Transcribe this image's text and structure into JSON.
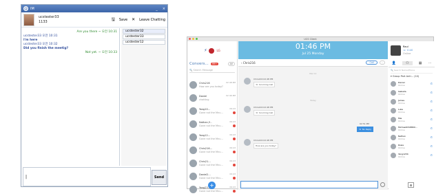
{
  "im": {
    "title": "IM",
    "ctrl_min": "_",
    "ctrl_close": "×",
    "user_name": "ucstester33",
    "user_id": "1133",
    "save_label": "Save",
    "leave_label": "Leave Chatting",
    "messages": [
      {
        "side": "r",
        "text": "Are you there ~ 오전 10:31"
      },
      {
        "side": "l",
        "text": "ucstester33  오전 10:31"
      },
      {
        "side": "l2",
        "text": "I'm here"
      },
      {
        "side": "l",
        "text": "ucstester33  오전 10:32"
      },
      {
        "side": "l2",
        "text": "Did you finish the meetig?"
      },
      {
        "side": "r",
        "text": "Not yet. ~ 오전 10:33"
      }
    ],
    "users": [
      "ucstester32",
      "ucstester33",
      "ucstester12"
    ],
    "send_label": "Send",
    "input_text": "|"
  },
  "ucs": {
    "window_title": "UCS Client",
    "brand_text": "LG",
    "time": "01:46 PM",
    "date": "Jul 25 Monday",
    "conv_title": "Convers...",
    "conv_badge": "99+",
    "conv_all": "All",
    "search_placeholder": "Search Message",
    "conversations": [
      {
        "name": "Chris216",
        "sub": "How are you today?",
        "time": "02:48 PM"
      },
      {
        "name": "Daniel",
        "sub": "chatting",
        "time": "02:46 PM"
      },
      {
        "name": "Yang10...",
        "sub": "Gone not the Mnu...",
        "time": "09:43"
      },
      {
        "name": "Nathan,Y...",
        "sub": "Gone not the Mnu...",
        "time": "09:43"
      },
      {
        "name": "Yang12...",
        "sub": "Gone not the Mnu...",
        "time": "09:43"
      },
      {
        "name": "Chris216...",
        "sub": "Gone not the Mnu...",
        "time": "09:43"
      },
      {
        "name": "Chris21...",
        "sub": "Gone not the Mnu...",
        "time": "09:43"
      },
      {
        "name": "Daniel2...",
        "sub": "Gone not the Mnu...",
        "time": "09:43"
      },
      {
        "name": "Yang23...",
        "sub": "Gone not the Mnu...",
        "time": "09:43"
      }
    ],
    "chat_with": "Chris216",
    "call_label": "Call",
    "divider1": "Mar 11",
    "divider2": "Today",
    "bubbles": [
      {
        "name": "Chris216   02:48 PM",
        "text": "Incoming Call"
      },
      {
        "name": "Chris216   02:48 PM",
        "text": "Incoming Call"
      },
      {
        "name": "Chris216   02:48 PM",
        "text": "How are you today?"
      }
    ],
    "self_time": "02:51 PM",
    "self_text": "No Reply",
    "me_name": "Raul",
    "me_ext": "1140",
    "me_status": "Online",
    "friend_search": "Search Name/Phone",
    "group_name": "Group Part Anti...",
    "group_count": "10",
    "friends": [
      {
        "name": "Daniel",
        "status": "Online"
      },
      {
        "name": "Isabella",
        "status": "Online"
      },
      {
        "name": "James",
        "status": "Online"
      },
      {
        "name": "Luke",
        "status": "Online"
      },
      {
        "name": "Mia",
        "status": "Online"
      },
      {
        "name": "Michael0318800...",
        "status": "Online"
      },
      {
        "name": "Nathan",
        "status": "Online"
      },
      {
        "name": "Rosia",
        "status": "Online"
      },
      {
        "name": "Yang1234",
        "status": "Online"
      }
    ]
  }
}
